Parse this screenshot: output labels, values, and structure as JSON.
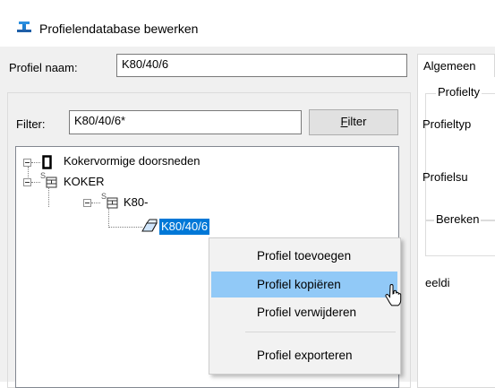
{
  "window": {
    "title": "Profielendatabase bewerken"
  },
  "profile_name": {
    "label": "Profiel naam:",
    "value": "K80/40/6"
  },
  "filter": {
    "label": "Filter:",
    "value": "K80/40/6*",
    "button": "Filter",
    "button_accel": "F",
    "button_rest": "ilter"
  },
  "tree": {
    "root": "Kokervormige doorsneden",
    "level1": "KOKER",
    "level2": "K80-",
    "leaf": "K80/40/6",
    "sup_mark": "S"
  },
  "right_panel": {
    "tab": "Algemeen",
    "group1_title": "Profielty",
    "field1": "Profieltyp",
    "field2": "Profielsu",
    "group2_title": "Bereken",
    "partial": "eeldi"
  },
  "context_menu": {
    "items": [
      {
        "label": "Profiel toevoegen",
        "highlighted": false
      },
      {
        "label": "Profiel kopiëren",
        "highlighted": true
      },
      {
        "label": "Profiel verwijderen",
        "highlighted": false
      },
      {
        "label": "Profiel exporteren",
        "highlighted": false
      }
    ]
  },
  "colors": {
    "selection": "#0078d7",
    "menu_highlight": "#91c9f7"
  }
}
